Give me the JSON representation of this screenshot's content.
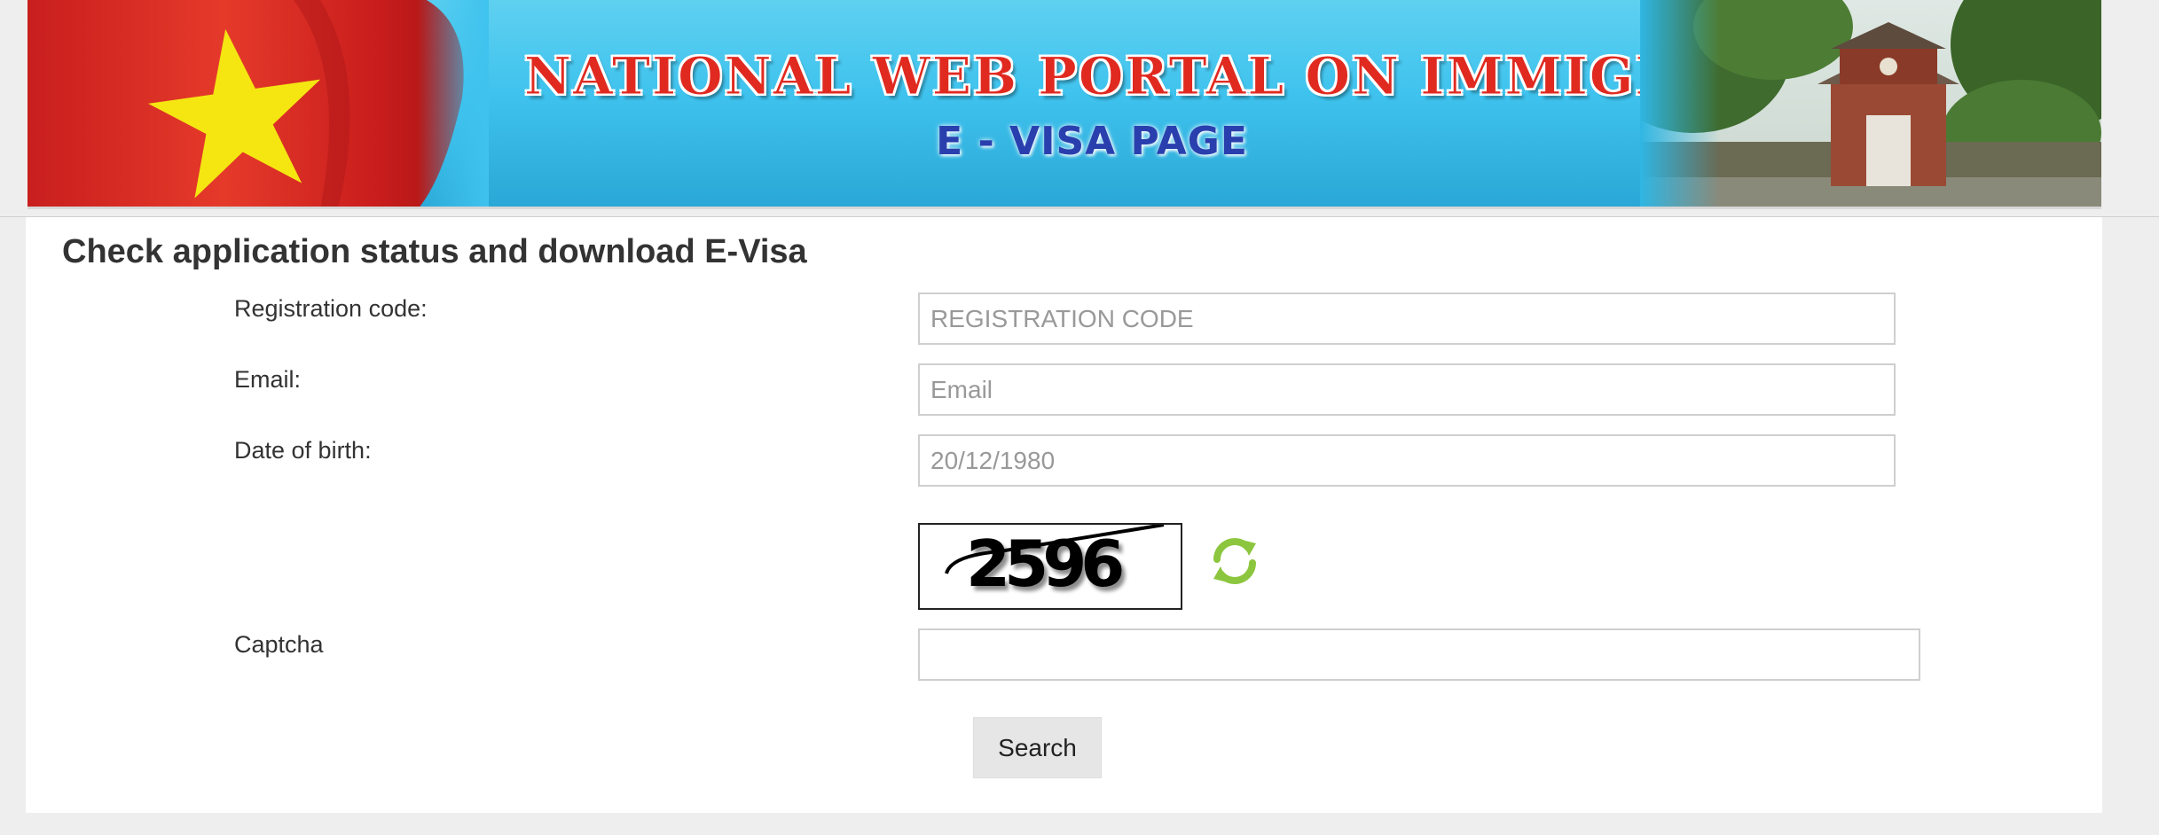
{
  "banner": {
    "title": "NATIONAL WEB PORTAL ON IMMIGRATION",
    "subtitle": "E - VISA PAGE"
  },
  "form": {
    "title": "Check application status and download E-Visa",
    "registration_code": {
      "label": "Registration code:",
      "placeholder": "REGISTRATION CODE"
    },
    "email": {
      "label": "Email:",
      "placeholder": "Email"
    },
    "date_of_birth": {
      "label": "Date of birth:",
      "placeholder": "20/12/1980"
    },
    "captcha": {
      "label": "Captcha",
      "image_text": "2596",
      "refresh_icon": "refresh-icon",
      "value": ""
    },
    "search_label": "Search"
  },
  "colors": {
    "banner_blue": "#3fc3ee",
    "title_red": "#e02a20",
    "subtitle_blue": "#2a3fae",
    "refresh_green": "#8cc63f",
    "button_bg": "#e6e6e6"
  }
}
